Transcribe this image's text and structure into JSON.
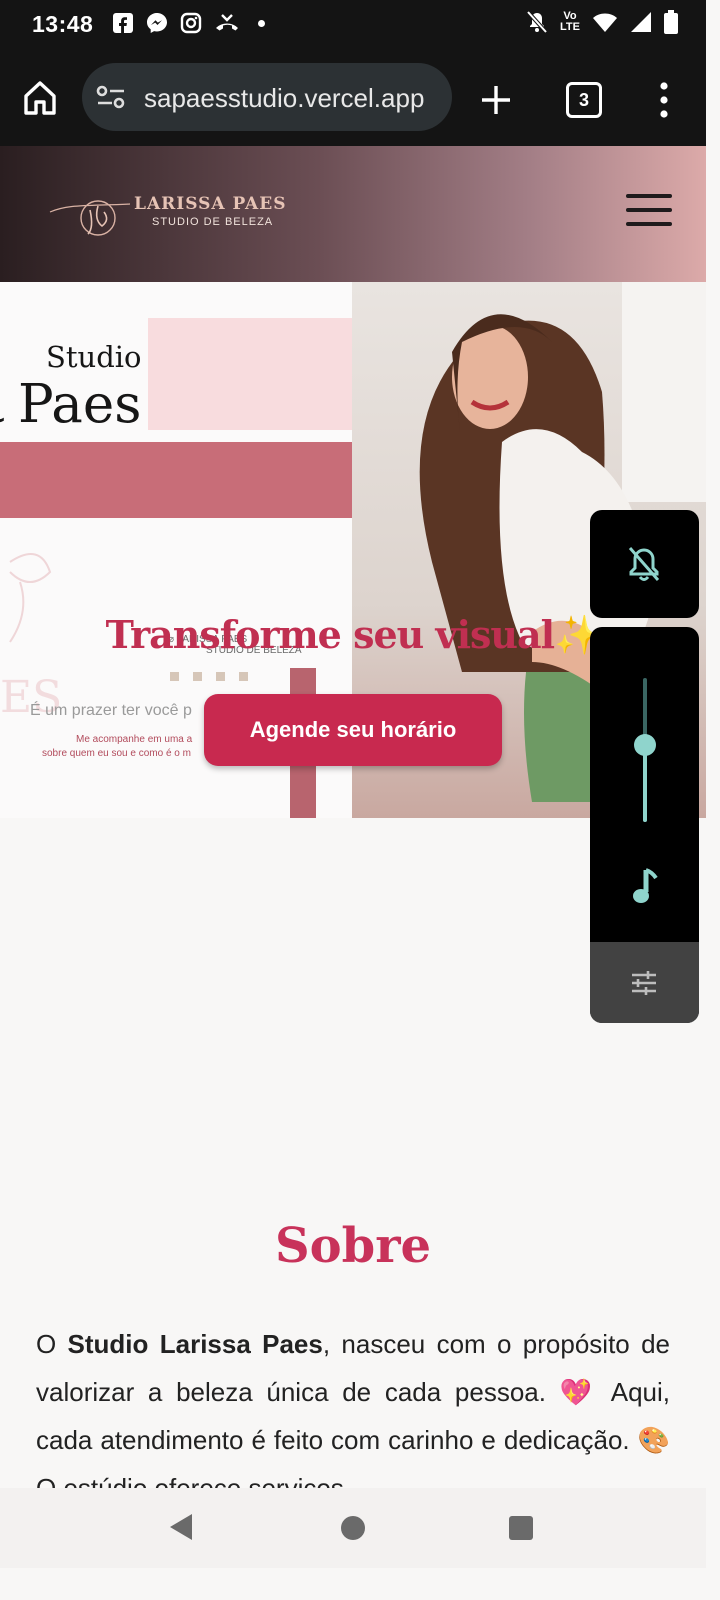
{
  "status_bar": {
    "time": "13:48",
    "left_icons": [
      "facebook-icon",
      "messenger-icon",
      "instagram-icon",
      "missed-call-icon",
      "more-dot-icon"
    ],
    "right_icons": [
      "mute-icon",
      "volte-icon",
      "wifi-icon",
      "signal-icon",
      "battery-icon"
    ],
    "volte_top": "Vo",
    "volte_bottom": "LTE"
  },
  "browser": {
    "url": "larissapaesstudio.vercel.app",
    "url_visible": "sapaesstudio.vercel.app",
    "tab_count": "3"
  },
  "header": {
    "logo_name": "LARISSA PAES",
    "logo_subtitle": "STUDIO DE BELEZA"
  },
  "hero": {
    "image_text": {
      "studio": "Studio",
      "paes": "Paes",
      "mini_logo_name": "LARISSA PAES",
      "mini_logo_sub": "STUDIO DE BELEZA",
      "prazer": "É um prazer ter você p",
      "line1": "Me acompanhe  em uma a",
      "line2": "sobre quem  eu sou e como é o m"
    },
    "title": "Transforme seu visual✨",
    "cta_label": "Agende seu horário"
  },
  "volume_overlay": {
    "level": 0.53,
    "icons": [
      "ringer-muted-icon",
      "music-note-icon",
      "sliders-icon"
    ]
  },
  "about": {
    "title": "Sobre",
    "text_intro": "O ",
    "text_bold": "Studio Larissa Paes",
    "text_rest": ", nasceu com o propósito de valorizar a beleza única de cada pessoa. 💖 Aqui, cada atendimento é feito com carinho e dedicação. 🎨 O estúdio oferece serviços"
  },
  "colors": {
    "accent": "#c8294f",
    "title_pink": "#c8325a",
    "mauve": "#c86d78",
    "volume_accent": "#8fd4cc"
  }
}
